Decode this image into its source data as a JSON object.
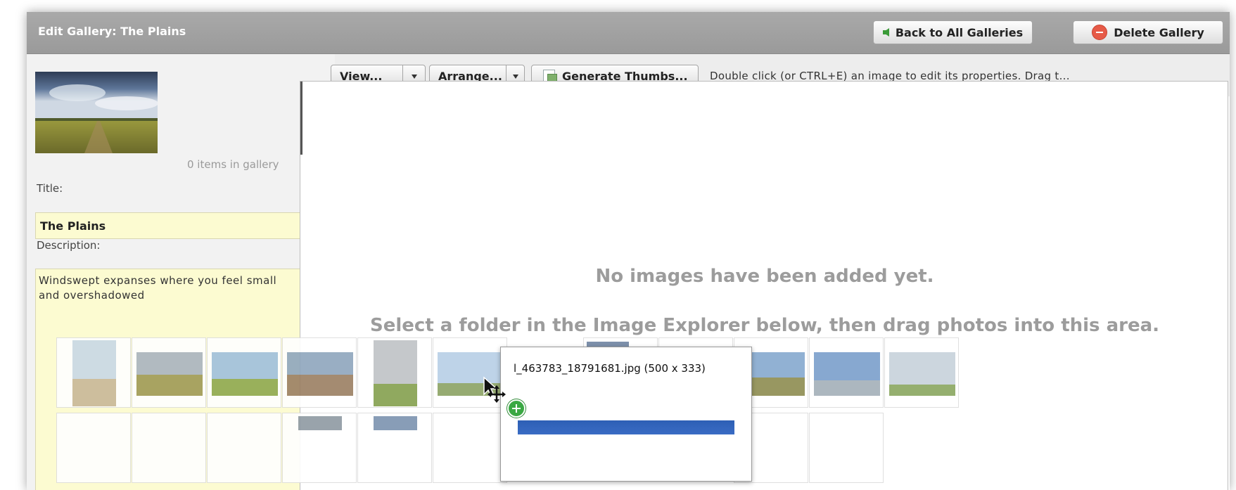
{
  "window": {
    "title": "Edit Gallery: The Plains",
    "back_label": "Back to All Galleries",
    "delete_label": "Delete Gallery"
  },
  "left": {
    "count_text": "0 items in gallery",
    "title_label": "Title:",
    "title_value": "The Plains",
    "desc_label": "Description:",
    "desc_value": "Windswept expanses where you feel small and overshadowed"
  },
  "toolbar": {
    "view_label": "View...",
    "arrange_label": "Arrange...",
    "generate_label": "Generate Thumbs...",
    "hint": "Double click (or CTRL+E) an image to edit its properties.  Drag t..."
  },
  "droparea": {
    "empty_line1": "No images have been added yet.",
    "empty_line2": "Select a folder in the Image Explorer below, then drag photos into this area."
  },
  "drag_tooltip": {
    "filename": "l_463783_18791681.jpg (500 x 333)"
  },
  "colors": {
    "titlebar": "#9f9f9f",
    "field_bg": "#fcfbd1",
    "empty_text": "#9c9c9c",
    "add_badge": "#3aa843"
  }
}
